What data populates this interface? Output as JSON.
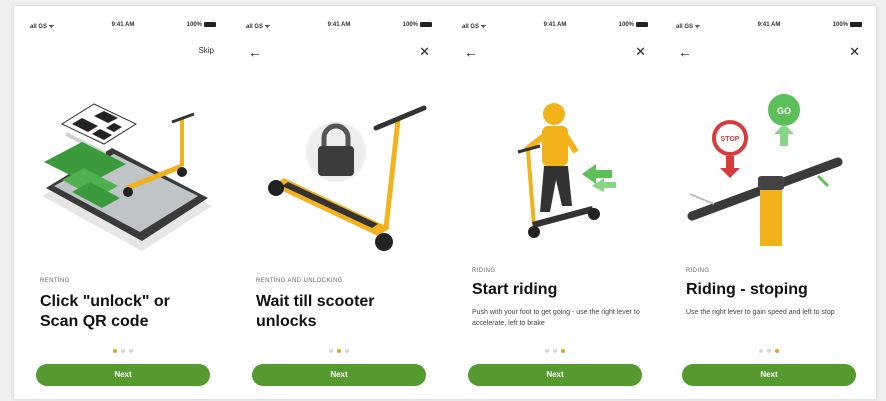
{
  "screens": [
    {
      "status": {
        "signal": "all GS ᯤ",
        "time": "9:41 AM",
        "battery": "100%"
      },
      "nav_right": "Skip",
      "eyebrow": "RENTING",
      "title": "Click \"unlock\" or Scan QR code",
      "body": "",
      "dots_active": 0,
      "button": "Next"
    },
    {
      "status": {
        "signal": "all GS ᯤ",
        "time": "9:41 AM",
        "battery": "100%"
      },
      "nav_left": "←",
      "nav_right": "✕",
      "eyebrow": "RENTING AND UNLOCKING",
      "title": "Wait till scooter unlocks",
      "body": "",
      "dots_active": 1,
      "button": "Next"
    },
    {
      "status": {
        "signal": "all GS ᯤ",
        "time": "9:41 AM",
        "battery": "100%"
      },
      "nav_left": "←",
      "nav_right": "✕",
      "eyebrow": "RIDING",
      "title": "Start riding",
      "body": "Push with your foot to get going - use the right lever to accelerate, left to brake",
      "dots_active": 2,
      "button": "Next"
    },
    {
      "status": {
        "signal": "all GS ᯤ",
        "time": "9:41 AM",
        "battery": "100%"
      },
      "nav_left": "←",
      "nav_right": "✕",
      "eyebrow": "RIDING",
      "title": "Riding - stoping",
      "body": "Use the right lever to gain speed and left to stop",
      "dots_active": 2,
      "button": "Next"
    }
  ],
  "signs": {
    "stop": "STOP",
    "go": "GO"
  },
  "colors": {
    "accent_green": "#559a2f",
    "scooter_yellow": "#f2b21b",
    "dot_active": "#e2a51a",
    "dot_inactive": "#d8d8d8"
  },
  "icons": [
    "back-arrow-icon",
    "close-icon",
    "battery-icon",
    "qr-code-icon",
    "padlock-icon"
  ]
}
